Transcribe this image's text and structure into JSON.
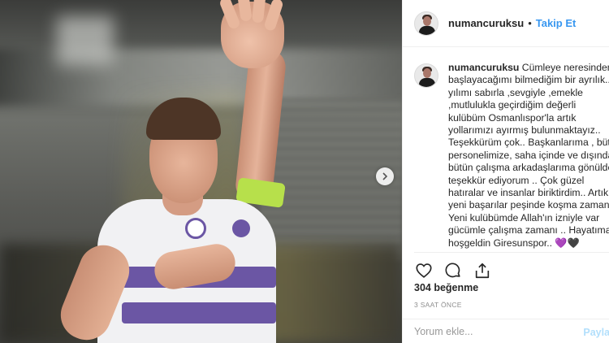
{
  "header": {
    "username": "numancuruksu",
    "separator": "•",
    "follow_label": "Takip Et"
  },
  "caption": {
    "username": "numancuruksu",
    "lines": [
      " Cümleye neresinden",
      "başlayacağımı bilmediğim bir ayrılık..",
      "yılımı sabırla ,sevgiyle ,emekle",
      ",mutlulukla geçirdiğim değerli",
      "kulübüm Osmanlıspor'la artık",
      "yollarımızı ayırmış bulunmaktayız..",
      "Teşekkürüm çok.. Başkanlarıma , bütün",
      "personelimize, saha içinde ve dışında",
      "bütün çalışma arkadaşlarıma gönülden",
      "teşekkür ediyorum .. Çok güzel",
      "hatıralar ve insanlar biriktirdim.. Artık",
      "yeni başarılar peşinde koşma zamanı..",
      "Yeni kulübümde Allah'ın izniyle var",
      "gücümle çalışma zamanı .. Hayatıma",
      "hoşgeldin Giresunspor.. 💜🖤"
    ]
  },
  "stats": {
    "likes": "304 beğenme",
    "timestamp": "3 SAAT ÖNCE"
  },
  "comment_box": {
    "placeholder": "Yorum ekle...",
    "post_label": "Paylaş"
  },
  "icons": {
    "like": "heart-icon",
    "comment": "comment-icon",
    "share": "share-icon",
    "next": "chevron-right-icon"
  },
  "colors": {
    "follow": "#3897f0",
    "armband": "#b7e04b",
    "kit_stripe": "#6b56a4"
  }
}
